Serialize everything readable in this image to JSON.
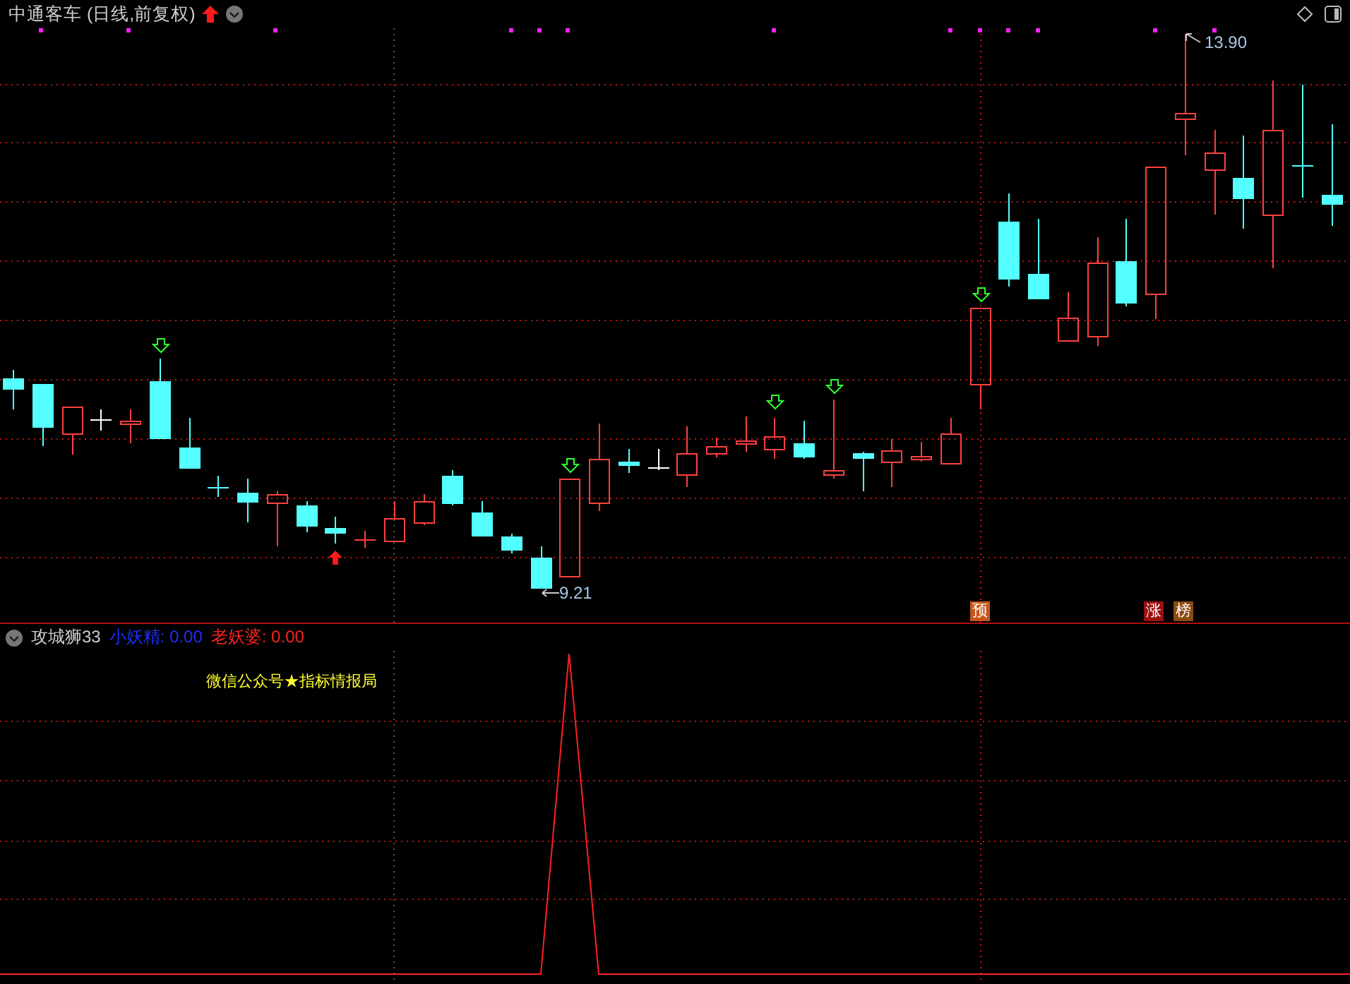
{
  "chart_header": {
    "title": "中通客车 (日线,前复权)"
  },
  "price_labels": {
    "high": "13.90",
    "low": "9.21"
  },
  "signal_badges": [
    {
      "label": "预",
      "color": "#c8561a"
    },
    {
      "label": "涨",
      "color": "#9c1010"
    },
    {
      "label": "榜",
      "color": "#8a4a10"
    }
  ],
  "indicator": {
    "name": "攻城狮33",
    "values": [
      {
        "label": "小妖精: 0.00",
        "color": "#1a2fff"
      },
      {
        "label": "老妖婆: 0.00",
        "color": "#ff2020"
      }
    ],
    "note": "微信公众号★指标情报局"
  }
}
